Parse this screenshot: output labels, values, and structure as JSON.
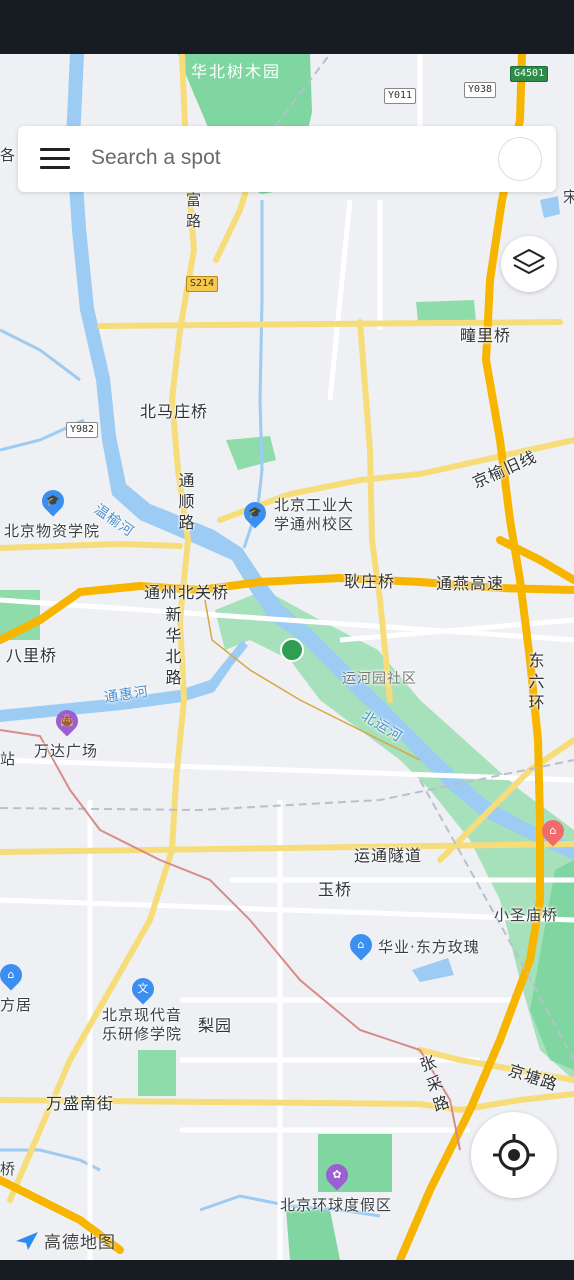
{
  "search": {
    "placeholder": "Search a spot"
  },
  "attribution": "高德地图",
  "labels": {
    "huabei_park": "华北树木园",
    "fu_road": "富路",
    "ge_partial": "各",
    "song_partial": "宋",
    "beimazhuang": "北马庄桥",
    "tongshun_road": "通顺路",
    "wenyu_river": "温榆河",
    "wuzi_college": "北京物资学院",
    "bgd_campus": "北京工业大学通州校区",
    "tongzhou_beiguan": "通州北关桥",
    "gengzhuang": "耿庄桥",
    "tongyan_highway": "通燕高速",
    "jingyu_old": "京榆旧线",
    "tongli": "疃里桥",
    "xinhua_north": "新华北路",
    "balitiao": "八里桥",
    "tonghui_river": "通惠河",
    "yunheyuan": "运河园社区",
    "bei_yunhe": "北运河",
    "dongliu_ring": "东六环",
    "wanda": "万达广场",
    "zhan_partial": "站",
    "yuntong_tunnel": "运通隧道",
    "yuqiao": "玉桥",
    "xiaoshengmiao": "小圣庙桥",
    "huaye": "华业·东方玫瑰",
    "fangju": "方居",
    "modern_music": "北京现代音乐研修学院",
    "liyuan": "梨园",
    "zhangcai_road": "张采路",
    "jingtang_road": "京塘路",
    "wansheng_south": "万盛南街",
    "qiao_partial": "桥",
    "universal_resort": "北京环球度假区"
  },
  "shields": {
    "g4501": "G4501",
    "y011": "Y011",
    "y038": "Y038",
    "s214": "S214",
    "y982": "Y982"
  },
  "icons": {
    "menu": "menu-icon",
    "layers": "layers-icon",
    "locate": "locate-icon",
    "college": "graduation-cap-icon",
    "mall": "shopping-bag-icon",
    "residence": "building-icon",
    "park_poi": "park-icon",
    "resort": "theme-park-icon"
  },
  "colors": {
    "map_bg": "#eef0f3",
    "water": "#9ccbf3",
    "park": "#7fd6a1",
    "major_road": "#f7b500",
    "minor_road": "#f6dd7a",
    "poi_blue": "#3b8ff0",
    "poi_purple": "#9b5fd3",
    "status_bar": "#171c22"
  }
}
